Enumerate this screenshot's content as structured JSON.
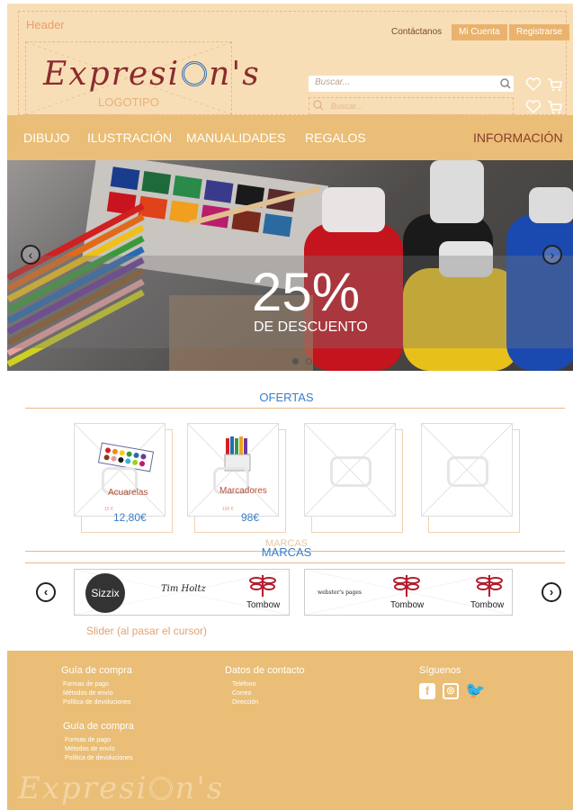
{
  "header": {
    "label": "Header",
    "logo_text": "Expresi",
    "logo_text_end": "n's",
    "logo_sub": "LOGOTIPO",
    "contact": "Contáctanos",
    "account": "Mi Cuenta",
    "register": "Registrarse",
    "search_placeholder": "Buscar...",
    "search2_placeholder": "Buscar..."
  },
  "nav": {
    "items": [
      "DIBUJO",
      "ILUSTRACIÓN",
      "MANUALIDADES",
      "REGALOS"
    ],
    "info": "INFORMACIÓN"
  },
  "hero": {
    "percent": "25%",
    "subtitle": "DE DESCUENTO"
  },
  "offers": {
    "title": "OFERTAS",
    "items": [
      {
        "name": "Acuarelas",
        "old_price": "15 €",
        "price": "12,80€"
      },
      {
        "name": "Marcadores",
        "old_price": "100 €",
        "price": "98€"
      },
      {
        "name": "",
        "old_price": "",
        "price": ""
      },
      {
        "name": "",
        "old_price": "",
        "price": ""
      }
    ]
  },
  "brands": {
    "ghost_title": "MARCAS",
    "title": "MARCAS",
    "logos": [
      "Sizzix",
      "Tim Holtz",
      "Tombow",
      "webster's pages",
      "Tombow",
      "Tombow"
    ],
    "note": "Slider (al pasar el cursor)"
  },
  "footer": {
    "col1": {
      "title": "Guía de compra",
      "links": [
        "Formas de pago",
        "Métodos de envío",
        "Política de devoluciones"
      ]
    },
    "col2": {
      "title": "Datos de contacto",
      "links": [
        "Teléfono",
        "Correo",
        "Dirección"
      ]
    },
    "col3": {
      "title": "Síguenos"
    },
    "col4": {
      "title": "Guía de compra",
      "links": [
        "Formas de pago",
        "Métodos de envío",
        "Política de devoluciones"
      ]
    },
    "logo": "Expresi"
  }
}
